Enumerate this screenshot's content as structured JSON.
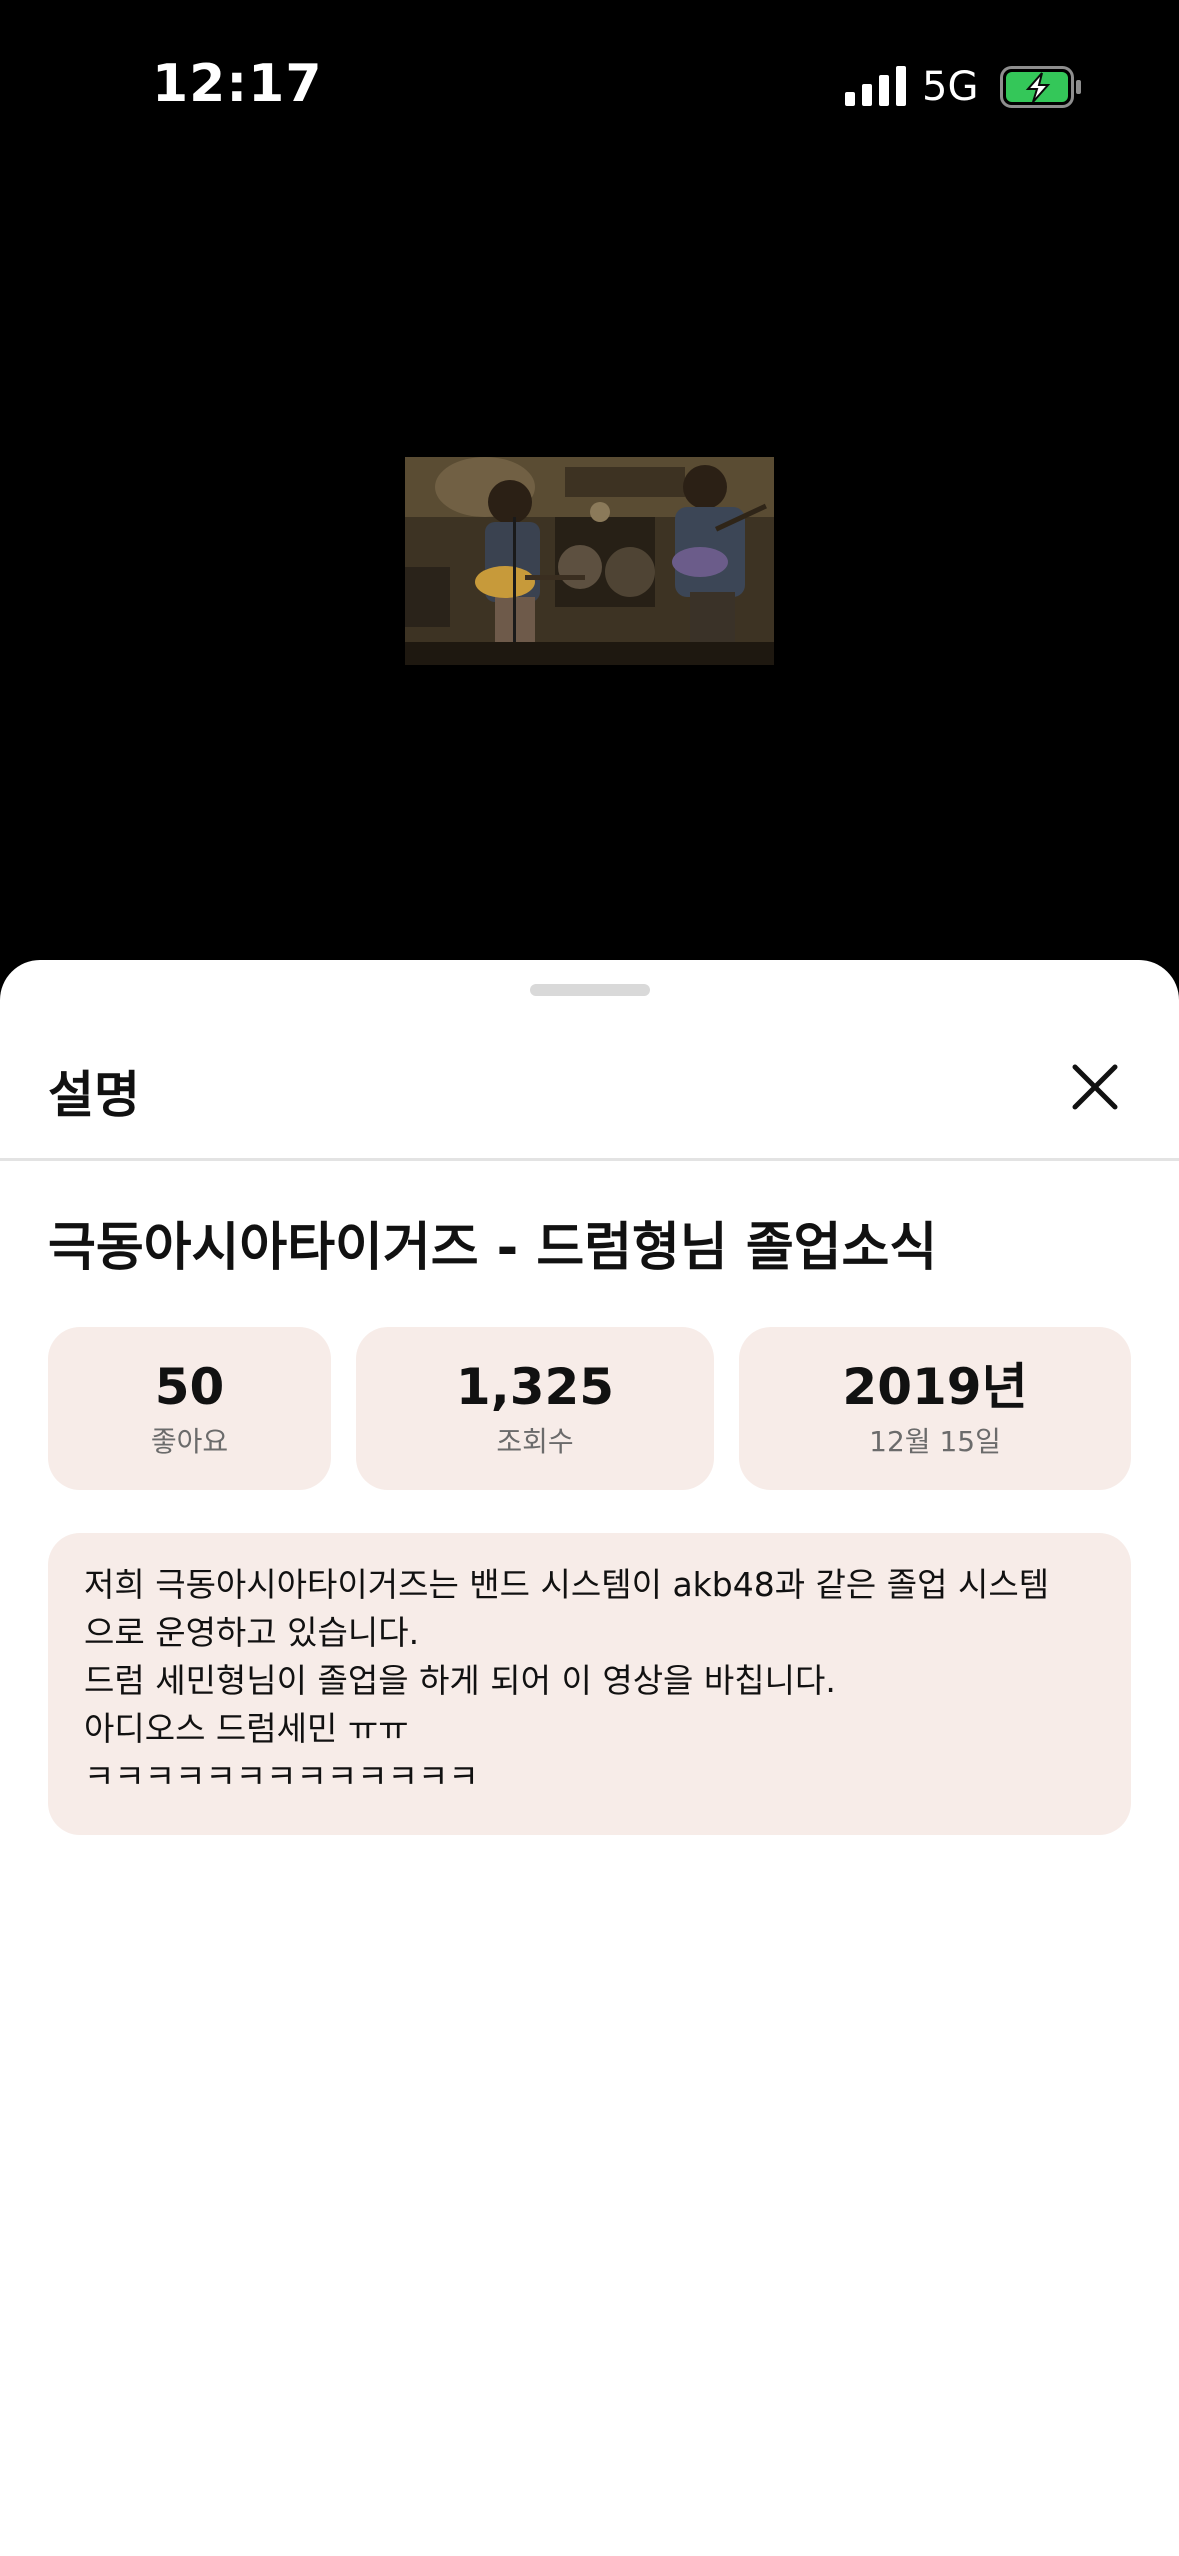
{
  "status_bar": {
    "time": "12:17",
    "network": "5G",
    "signal_icon": "signal-bars-icon",
    "battery_icon": "battery-charging-icon",
    "battery_color": "#34c759"
  },
  "video": {
    "thumbnail": "band-performance-thumbnail"
  },
  "sheet": {
    "title": "설명",
    "close_icon": "close-icon",
    "video_title": "극동아시아타이거즈 - 드럼형님 졸업소식",
    "stats": {
      "likes_value": "50",
      "likes_label": "좋아요",
      "views_value": "1,325",
      "views_label": "조회수",
      "date_value": "2019년",
      "date_label": "12월 15일"
    },
    "description": "저희 극동아시아타이거즈는 밴드 시스템이 akb48과 같은 졸업 시스템\n으로 운영하고 있습니다.\n드럼 세민형님이 졸업을 하게 되어 이 영상을 바칩니다.\n아디오스 드럼세민 ㅠㅠ\nㅋㅋㅋㅋㅋㅋㅋㅋㅋㅋㅋㅋㅋ",
    "card_color": "#f7ece8"
  }
}
